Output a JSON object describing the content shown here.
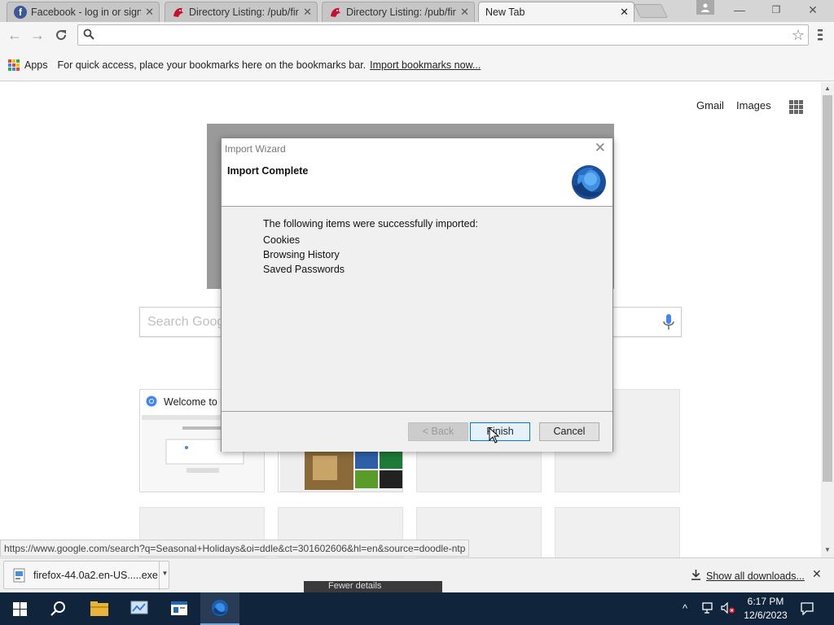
{
  "browser": {
    "tabs": [
      {
        "title": "Facebook - log in or sign up",
        "icon": "facebook-icon",
        "active": false
      },
      {
        "title": "Directory Listing: /pub/firefox",
        "icon": "mozilla-icon",
        "active": false
      },
      {
        "title": "Directory Listing: /pub/firefox",
        "icon": "mozilla-icon",
        "active": false
      },
      {
        "title": "New Tab",
        "icon": "",
        "active": true
      }
    ],
    "omnibox_value": "",
    "bookmarks_bar": {
      "apps_label": "Apps",
      "message": "For quick access, place your bookmarks here on the bookmarks bar.",
      "import_link": "Import bookmarks now..."
    }
  },
  "ntp": {
    "gmail": "Gmail",
    "images": "Images",
    "search_placeholder": "Search Google or type URL",
    "tiles": [
      {
        "title": "Welcome to Chrome",
        "icon": "chrome-icon"
      },
      {
        "title": "",
        "icon": ""
      }
    ]
  },
  "status_url": "https://www.google.com/search?q=Seasonal+Holidays&oi=ddle&ct=301602606&hl=en&source=doodle-ntp",
  "downloads": {
    "file_name": "firefox-44.0a2.en-US.....exe",
    "show_all": "Show all downloads..."
  },
  "dialog": {
    "title": "Import Wizard",
    "heading": "Import Complete",
    "intro": "The following items were successfully imported:",
    "items": [
      "Cookies",
      "Browsing History",
      "Saved Passwords"
    ],
    "buttons": {
      "back": "< Back",
      "finish": "Finish",
      "cancel": "Cancel"
    }
  },
  "taskbar": {
    "tooltip": "Fewer details",
    "time": "6:17 PM",
    "date": "12/6/2023"
  },
  "colors": {
    "taskbar": "#10243c",
    "accent": "#0078d7",
    "facebook": "#3b5998"
  }
}
